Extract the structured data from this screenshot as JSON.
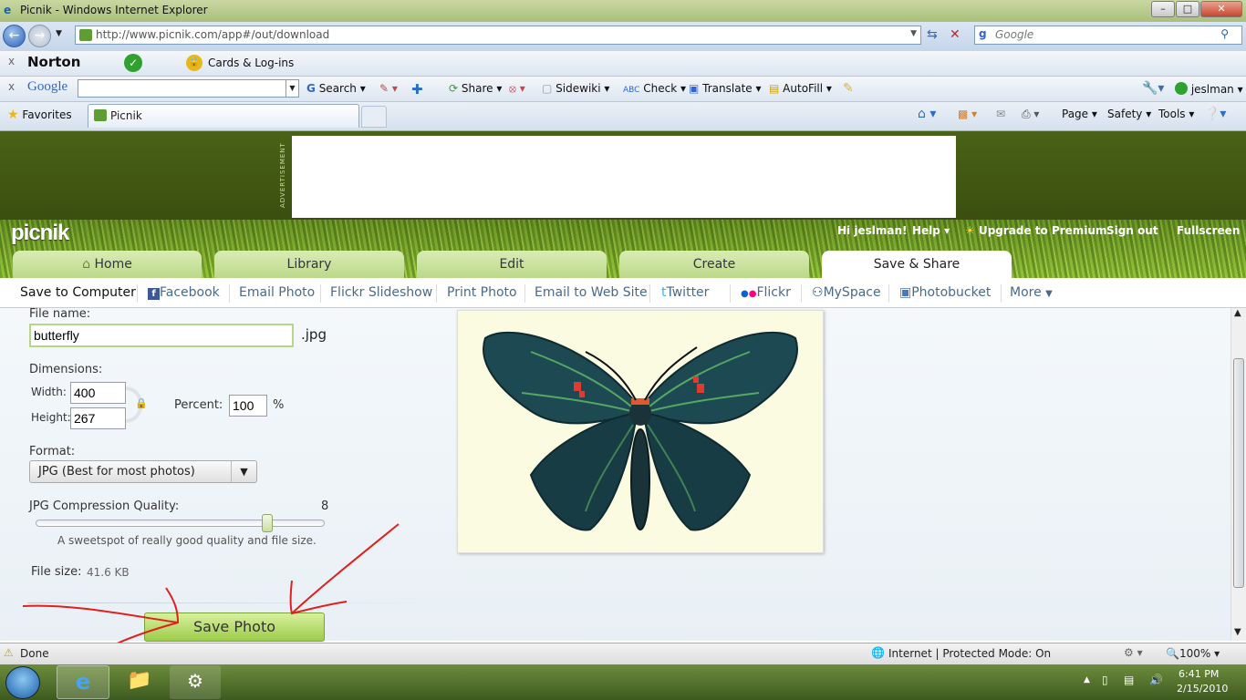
{
  "window": {
    "title": "Picnik - Windows Internet Explorer",
    "url": "http://www.picnik.com/app#/out/download",
    "search_placeholder": "Google"
  },
  "toolbars": {
    "norton": {
      "brand": "Norton",
      "cards": "Cards & Log-ins"
    },
    "google": {
      "brand": "Google",
      "search": "Search",
      "share": "Share",
      "sidewiki": "Sidewiki",
      "check": "Check",
      "translate": "Translate",
      "autofill": "AutoFill",
      "user": "jeslman"
    },
    "favorites": {
      "label": "Favorites",
      "tab_title": "Picnik",
      "page": "Page",
      "safety": "Safety",
      "tools": "Tools"
    }
  },
  "ad": {
    "label": "ADVERTISEMENT"
  },
  "picnik": {
    "logo": "picnik",
    "top_links": {
      "greeting": "Hi jeslman!",
      "help": "Help",
      "upgrade": "Upgrade to Premium",
      "signout": "Sign out",
      "fullscreen": "Fullscreen"
    },
    "tabs": [
      "Home",
      "Library",
      "Edit",
      "Create",
      "Save & Share"
    ],
    "subnav": [
      "Save to Computer",
      "Facebook",
      "Email Photo",
      "Flickr Slideshow",
      "Print Photo",
      "Email to Web Site",
      "Twitter",
      "Flickr",
      "MySpace",
      "Photobucket",
      "More"
    ]
  },
  "form": {
    "filename_label": "File name:",
    "filename_value": "butterfly",
    "ext": ".jpg",
    "dimensions_label": "Dimensions:",
    "width_label": "Width:",
    "width_value": "400",
    "height_label": "Height:",
    "height_value": "267",
    "percent_label": "Percent:",
    "percent_value": "100",
    "percent_unit": "%",
    "format_label": "Format:",
    "format_value": "JPG  (Best for most photos)",
    "quality_label": "JPG Compression Quality:",
    "quality_value": "8",
    "quality_fraction": 0.8,
    "quality_hint": "A sweetspot of really good quality and file size.",
    "filesize_label": "File size:",
    "filesize_value": "41.6 KB",
    "save_button": "Save Photo"
  },
  "statusbar": {
    "status": "Done",
    "zone": "Internet | Protected Mode: On",
    "zoom": "100%"
  },
  "clock": {
    "time": "6:41 PM",
    "date": "2/15/2010"
  },
  "colors": {
    "accent_green": "#9ccc4a",
    "annotation_red": "#e0201e"
  }
}
